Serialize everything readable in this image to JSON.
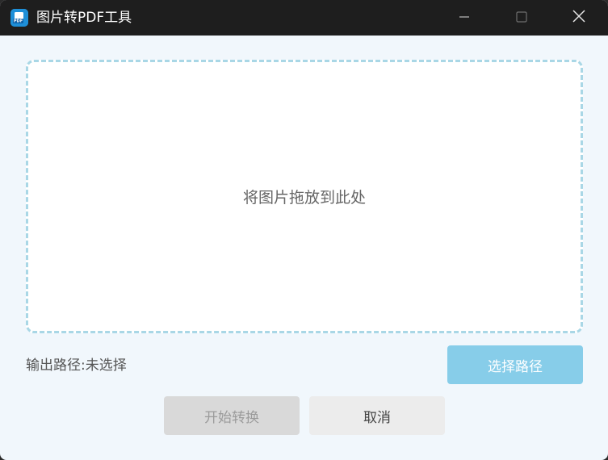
{
  "window": {
    "title": "图片转PDF工具",
    "app_icon": "pdf-app-icon",
    "controls": {
      "minimize_icon": "minimize-icon",
      "maximize_icon": "maximize-icon",
      "close_icon": "close-icon"
    }
  },
  "dropzone": {
    "text": "将图片拖放到此处"
  },
  "output": {
    "label": "输出路径:未选择"
  },
  "buttons": {
    "choose_path": "选择路径",
    "start_convert": "开始转换",
    "cancel": "取消"
  },
  "colors": {
    "titlebar": "#1e1e1e",
    "window_bg": "#f1f7fc",
    "dropzone_border": "#a9d7e6",
    "choose_button": "#87cde9",
    "start_button_disabled": "#d9d9d9",
    "cancel_button": "#ececec"
  }
}
